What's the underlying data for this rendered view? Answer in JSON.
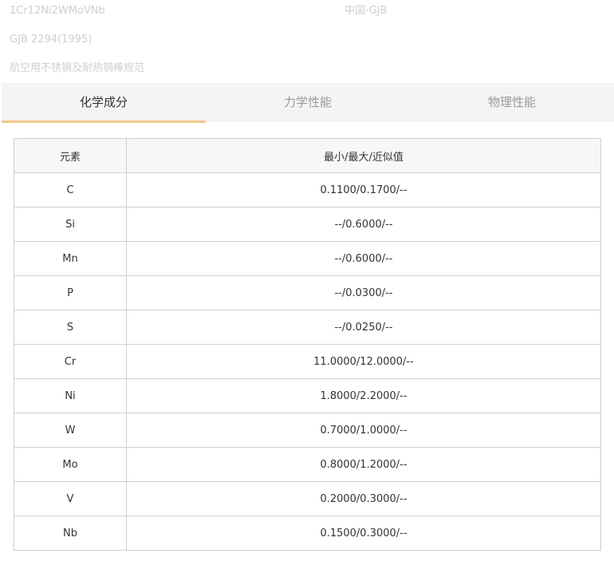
{
  "header": {
    "grade": "1Cr12Ni2WMoVNb",
    "origin": "中国-GJB",
    "standard": "GJB 2294(1995)",
    "standard_name": "航空用不锈钢及耐热钢棒规范"
  },
  "tabs": [
    {
      "label": "化学成分",
      "active": true
    },
    {
      "label": "力学性能",
      "active": false
    },
    {
      "label": "物理性能",
      "active": false
    }
  ],
  "table": {
    "headers": [
      "元素",
      "最小/最大/近似值"
    ],
    "rows": [
      {
        "element": "C",
        "value": "0.1100/0.1700/--"
      },
      {
        "element": "Si",
        "value": "--/0.6000/--"
      },
      {
        "element": "Mn",
        "value": "--/0.6000/--"
      },
      {
        "element": "P",
        "value": "--/0.0300/--"
      },
      {
        "element": "S",
        "value": "--/0.0250/--"
      },
      {
        "element": "Cr",
        "value": "11.0000/12.0000/--"
      },
      {
        "element": "Ni",
        "value": "1.8000/2.2000/--"
      },
      {
        "element": "W",
        "value": "0.7000/1.0000/--"
      },
      {
        "element": "Mo",
        "value": "0.8000/1.2000/--"
      },
      {
        "element": "V",
        "value": "0.2000/0.3000/--"
      },
      {
        "element": "Nb",
        "value": "0.1500/0.3000/--"
      }
    ]
  },
  "colors": {
    "tab_active_underline": "#f0c88a",
    "tabbar_bg": "#f4f4f4",
    "faint_text": "#cfcfcf"
  }
}
